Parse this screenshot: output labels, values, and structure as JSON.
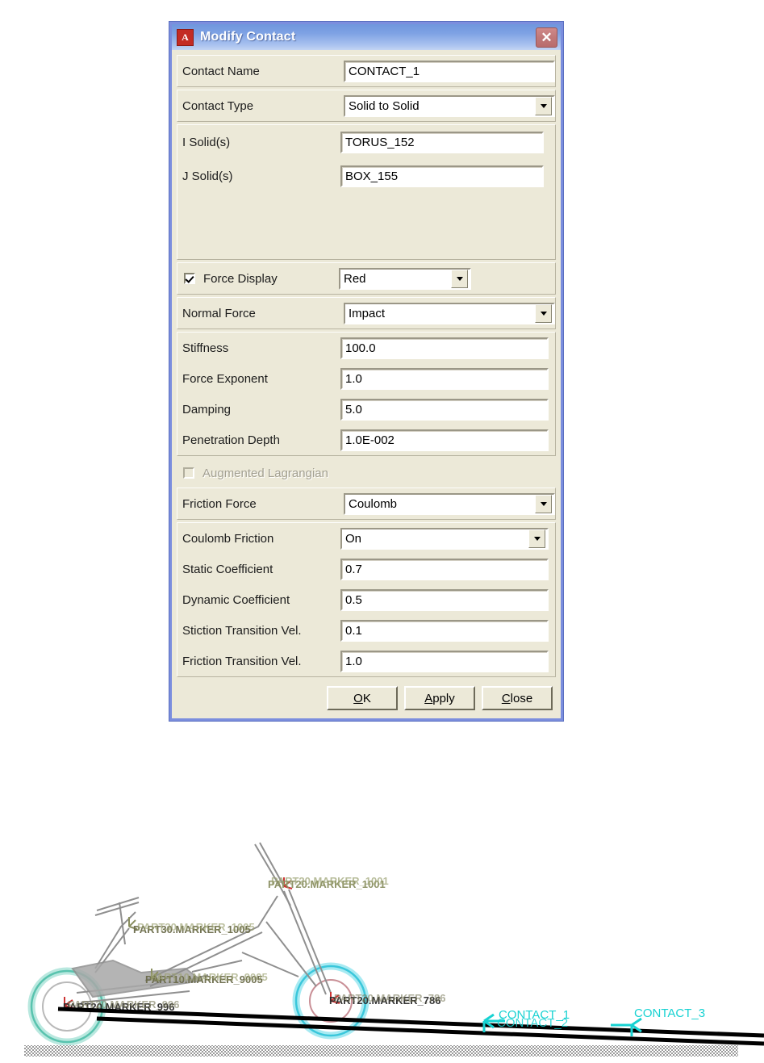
{
  "dialog": {
    "title": "Modify Contact",
    "app_icon_letter": "A",
    "close_icon": "close-icon",
    "titlebar_color": "#7ea2e4",
    "body_color": "#ece9d8",
    "fields": {
      "contact_name_label": "Contact Name",
      "contact_name_value": "CONTACT_1",
      "contact_type_label": "Contact Type",
      "contact_type_value": "Solid to Solid",
      "i_solid_label": "I Solid(s)",
      "i_solid_value": "TORUS_152",
      "j_solid_label": "J Solid(s)",
      "j_solid_value": "BOX_155",
      "force_display_label": "Force Display",
      "force_display_checked": true,
      "force_display_value": "Red",
      "normal_force_label": "Normal Force",
      "normal_force_value": "Impact",
      "stiffness_label": "Stiffness",
      "stiffness_value": "100.0",
      "force_exponent_label": "Force Exponent",
      "force_exponent_value": "1.0",
      "damping_label": "Damping",
      "damping_value": "5.0",
      "penetration_depth_label": "Penetration Depth",
      "penetration_depth_value": "1.0E-002",
      "augmented_lagrangian_label": "Augmented Lagrangian",
      "augmented_lagrangian_checked": false,
      "friction_force_label": "Friction Force",
      "friction_force_value": "Coulomb",
      "coulomb_friction_label": "Coulomb Friction",
      "coulomb_friction_value": "On",
      "static_coefficient_label": "Static Coefficient",
      "static_coefficient_value": "0.7",
      "dynamic_coefficient_label": "Dynamic Coefficient",
      "dynamic_coefficient_value": "0.5",
      "stiction_transition_label": "Stiction Transition Vel.",
      "stiction_transition_value": "0.1",
      "friction_transition_label": "Friction Transition Vel.",
      "friction_transition_value": "1.0"
    },
    "buttons": {
      "ok": "OK",
      "ok_mnemonic": "O",
      "ok_rest": "K",
      "apply": "Apply",
      "apply_mnemonic": "A",
      "apply_rest": "pply",
      "close": "Close",
      "close_mnemonic": "C",
      "close_rest": "lose"
    }
  },
  "viewport": {
    "marker_labels": [
      "PART20.MARKER_1001",
      "PART30.MARKER_1005",
      "PART10.MARKER_9005",
      "PART20.MARKER_996",
      "PART20.MARKER_786"
    ],
    "contact_labels": [
      "CONTACT_1",
      "CONTACT_2",
      "CONTACT_3"
    ],
    "contact_color": "#17d2d2",
    "marker_color": "#8a8f60",
    "wheel_front_color": "#7fd6c4",
    "wheel_rear_color": "#5fd9e8",
    "ground_color": "#9a9a9a"
  }
}
